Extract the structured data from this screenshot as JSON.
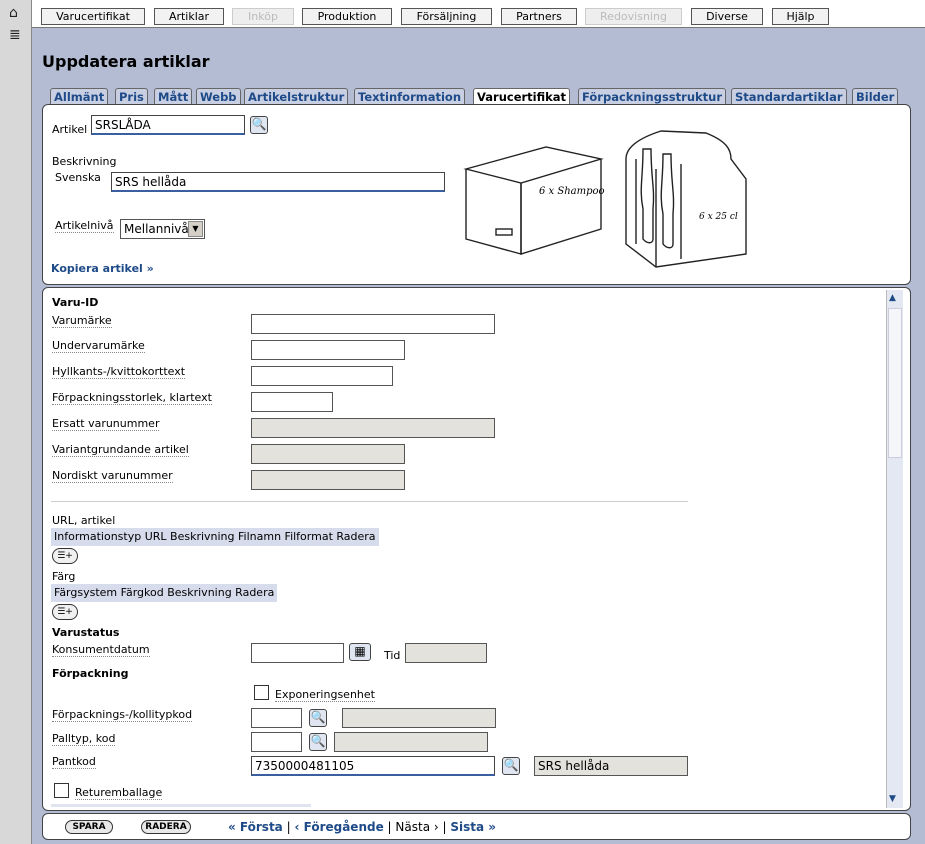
{
  "leftbar": {
    "home_icon": "home-icon",
    "list_icon": "list-icon"
  },
  "nav": [
    "Varucertifikat",
    "Artiklar",
    "Inköp",
    "Produktion",
    "Försäljning",
    "Partners",
    "Redovisning",
    "Diverse",
    "Hjälp"
  ],
  "page_title": "Uppdatera artiklar",
  "tabs": [
    "Allmänt",
    "Pris",
    "Mått",
    "Webb",
    "Artikelstruktur",
    "Textinformation",
    "Varucertifikat",
    "Förpackningsstruktur",
    "Standardartiklar",
    "Bilder"
  ],
  "active_tab": "Varucertifikat",
  "header": {
    "artikel_label": "Artikel",
    "artikel_value": "SRSLÅDA",
    "beskrivning_label": "Beskrivning",
    "svenska_label": "Svenska",
    "svenska_value": "SRS hellåda",
    "niva_label": "Artikelnivå",
    "niva_value": "Mellannivå",
    "copy_link": "Kopiera artikel »",
    "box_text": "6 x\nShampoo",
    "bottle_text": "6 x 25 cl"
  },
  "form": {
    "varu_id_heading": "Varu-ID",
    "fields": [
      "Varumärke",
      "Undervarumärke",
      "Hyllkants-/kvittokorttext",
      "Förpackningsstorlek, klartext",
      "Ersatt varunummer",
      "Variantgrundande artikel",
      "Nordiskt varunummer"
    ],
    "url_label": "URL, artikel",
    "url_columns": "Informationstyp URL Beskrivning Filnamn Filformat Radera",
    "farg_label": "Färg",
    "farg_columns": "Färgsystem Färgkod Beskrivning Radera",
    "varustatus_heading": "Varustatus",
    "konsument_label": "Konsumentdatum",
    "tid_label": "Tid",
    "forpackning_heading": "Förpackning",
    "exponering_label": "Exponeringsenhet",
    "kolli_label": "Förpacknings-/kollitypkod",
    "pall_label": "Palltyp, kod",
    "pant_label": "Pantkod",
    "pant_value": "7350000481105",
    "pant_desc": "SRS hellåda",
    "retur_label": "Returemballage"
  },
  "footer": {
    "save": "SPARA",
    "delete": "RADERA",
    "first": "« Första",
    "prev": "‹ Föregående",
    "next": "Nästa ›",
    "last": "Sista »",
    "sep": "|"
  },
  "colors": {
    "link": "#1e4a88",
    "background": "#b4bcd4"
  }
}
